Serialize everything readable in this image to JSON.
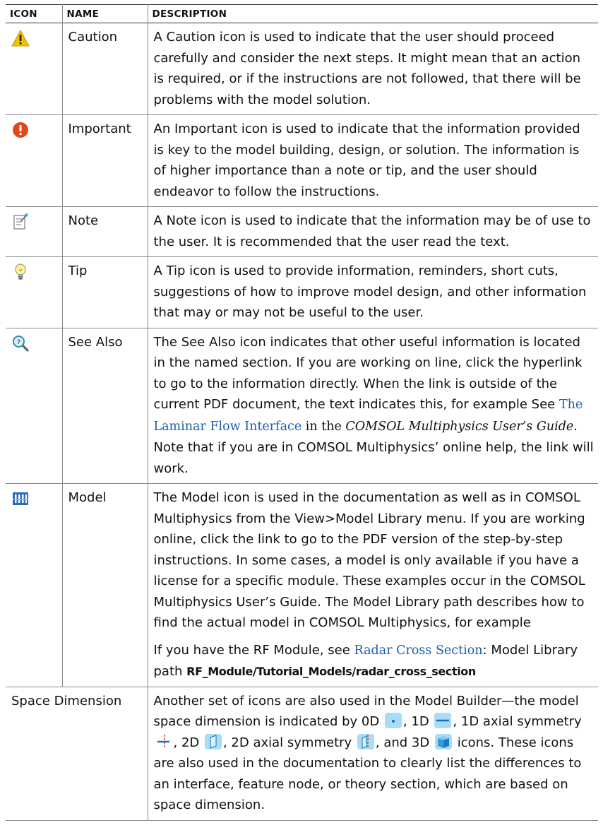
{
  "headers": {
    "icon": "ICON",
    "name": "NAME",
    "description": "DESCRIPTION"
  },
  "rows": [
    {
      "name": "Caution",
      "icon": "caution-triangle-icon",
      "description": "A Caution icon is used to indicate that the user should proceed carefully and consider the next steps. It might mean that an action is required, or if the instructions are not followed, that there will be problems with the model solution."
    },
    {
      "name": "Important",
      "icon": "important-exclamation-icon",
      "description": "An Important icon is used to indicate that the information provided is key to the model building, design, or solution. The information is of higher importance than a note or tip, and the user should endeavor to follow the instructions."
    },
    {
      "name": "Note",
      "icon": "note-page-icon",
      "description": "A Note icon is used to indicate that the information may be of use to the user. It is recommended that the user read the text."
    },
    {
      "name": "Tip",
      "icon": "tip-lightbulb-icon",
      "description": "A Tip icon is used to provide information, reminders, short cuts, suggestions of how to improve model design, and other information that may or may not be useful to the user."
    },
    {
      "name": "See Also",
      "icon": "see-also-magnifier-icon",
      "description": {
        "part1": "The See Also icon indicates that other useful information is located in the named section. If you are working on line, click the hyperlink to go to the information directly. When the link is outside of the current PDF document, the text indicates this, for example See ",
        "link": "The Laminar Flow Interface",
        "part2": " in the ",
        "guide": "COMSOL Multiphysics User’s Guide",
        "part3": ". Note that if you are in COMSOL Multiphysics’ online help, the link will work."
      }
    },
    {
      "name": "Model",
      "icon": "model-library-icon",
      "description": {
        "para1": "The Model icon is used in the documentation as well as in COMSOL Multiphysics from the View>Model Library menu. If you are working online, click the link to go to the PDF version of the step-by-step instructions. In some cases, a model is only available if you have a license for a specific module. These examples occur in the COMSOL Multiphysics User’s Guide. The Model Library path describes how to find the actual model in COMSOL Multiphysics, for example",
        "para2_pre": "If you have the RF Module, see ",
        "para2_link": "Radar Cross Section",
        "para2_mid": ": Model Library path ",
        "para2_path": "RF_Module/Tutorial_Models/radar_cross_section"
      }
    }
  ],
  "space_dimension": {
    "name": "Space Dimension",
    "t1": "Another set of icons are also used in the Model Builder—the model space dimension is indicated by 0D ",
    "t2": ", 1D ",
    "t3": ", 1D axial symmetry ",
    "t4": ", 2D ",
    "t5": ", 2D axial symmetry ",
    "t6": ", and 3D ",
    "t7": " icons. These icons are also used in the documentation to clearly list the differences to an interface, feature node, or theory section, which are based on space dimension.",
    "icons": [
      "0d-icon",
      "1d-icon",
      "1d-axial-symmetry-icon",
      "2d-icon",
      "2d-axial-symmetry-icon",
      "3d-icon"
    ]
  },
  "colors": {
    "link": "#1f5ea8",
    "caution": "#f2c200",
    "important": "#e2461a",
    "space_dim": "#a9dcf7"
  }
}
